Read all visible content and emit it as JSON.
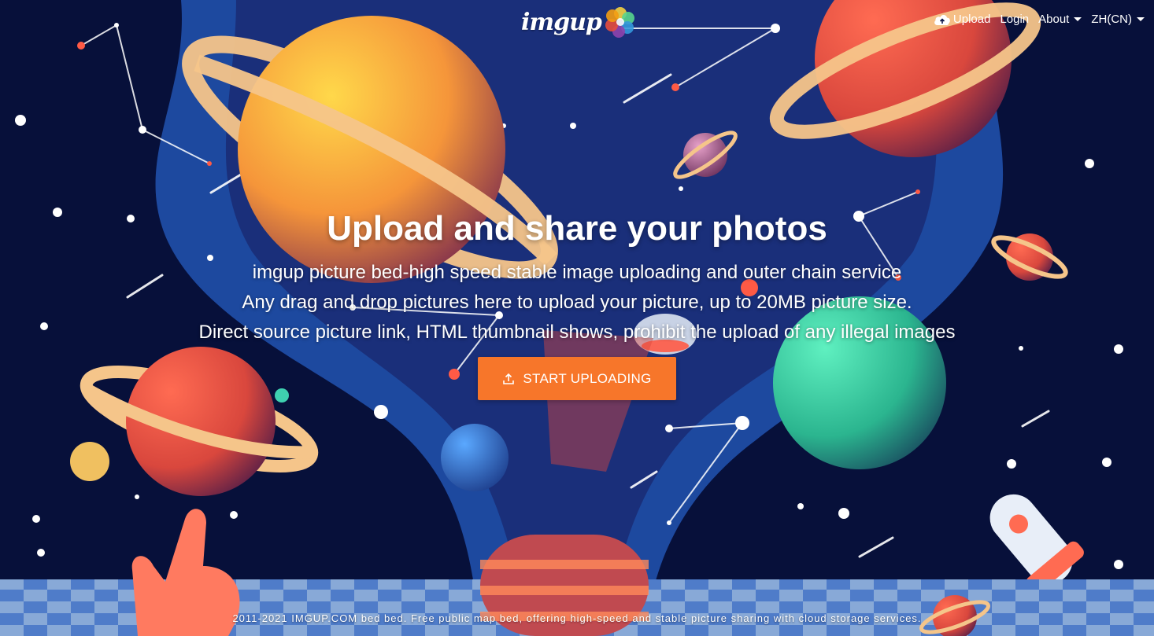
{
  "brand": {
    "name": "imgup",
    "logo_icon": "flower-logo-icon"
  },
  "nav": {
    "upload": {
      "label": "Upload",
      "icon": "cloud-upload-icon"
    },
    "login": {
      "label": "Login"
    },
    "about": {
      "label": "About",
      "icon": "caret-down-icon"
    },
    "language": {
      "label": "ZH(CN)",
      "icon": "caret-down-icon"
    }
  },
  "hero": {
    "title": "Upload and share your photos",
    "lines": [
      "imgup picture bed-high speed stable image uploading and outer chain service",
      "Any drag and drop pictures here to upload your picture, up to 20MB picture size.",
      "Direct source picture link, HTML thumbnail shows, prohibit the upload of any illegal images"
    ],
    "button": {
      "label": "START UPLOADING",
      "icon": "upload-icon"
    }
  },
  "footer": {
    "text": "2011-2021 IMGUP.COM bed bed. Free public map bed, offering high-speed and stable picture sharing with cloud storage services."
  },
  "colors": {
    "background": "#0b1447",
    "accent": "#f7762a",
    "text": "#ffffff"
  }
}
